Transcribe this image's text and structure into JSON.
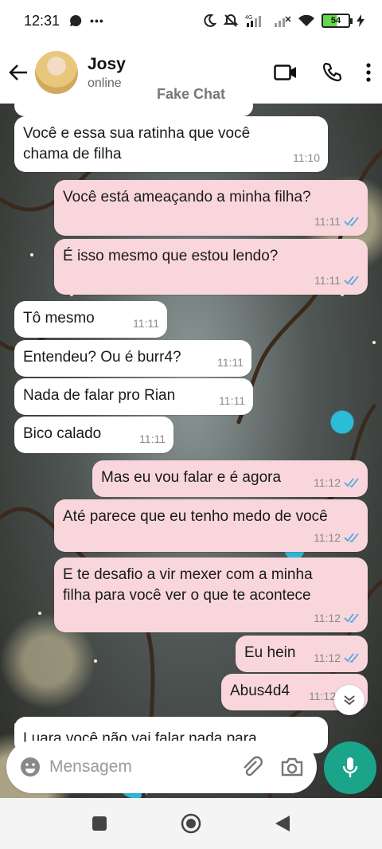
{
  "status": {
    "time": "12:31",
    "battery": "54"
  },
  "header": {
    "name": "Josy",
    "status": "online",
    "app_label": "Fake Chat"
  },
  "messages": [
    {
      "text": "Você e essa sua ratinha que você\nchama de filha",
      "time": "11:10"
    },
    {
      "text": "Você está ameaçando a minha filha?",
      "time": "11:11"
    },
    {
      "text": "É isso mesmo que estou lendo?",
      "time": "11:11"
    },
    {
      "text": "Tô mesmo",
      "time": "11:11"
    },
    {
      "text": "Entendeu? Ou é burr4?",
      "time": "11:11"
    },
    {
      "text": "Nada de falar pro Rian",
      "time": "11:11"
    },
    {
      "text": "Bico calado",
      "time": "11:11"
    },
    {
      "text": "Mas eu vou falar e é agora",
      "time": "11:12"
    },
    {
      "text": "Até parece que eu tenho medo de você",
      "time": "11:12"
    },
    {
      "text": "E te desafio a vir mexer com a minha\nfilha para você ver o que te acontece",
      "time": "11:12"
    },
    {
      "text": "Eu hein",
      "time": "11:12"
    },
    {
      "text": "Abus4d4",
      "time": "11:12"
    },
    {
      "text": "Luara você não vai falar nada para"
    }
  ],
  "input": {
    "placeholder": "Mensagem"
  },
  "colors": {
    "outgoing": "#f9d6dc",
    "incoming": "#ffffff",
    "accent": "#1aa58a",
    "tick": "#4fa8e0"
  }
}
